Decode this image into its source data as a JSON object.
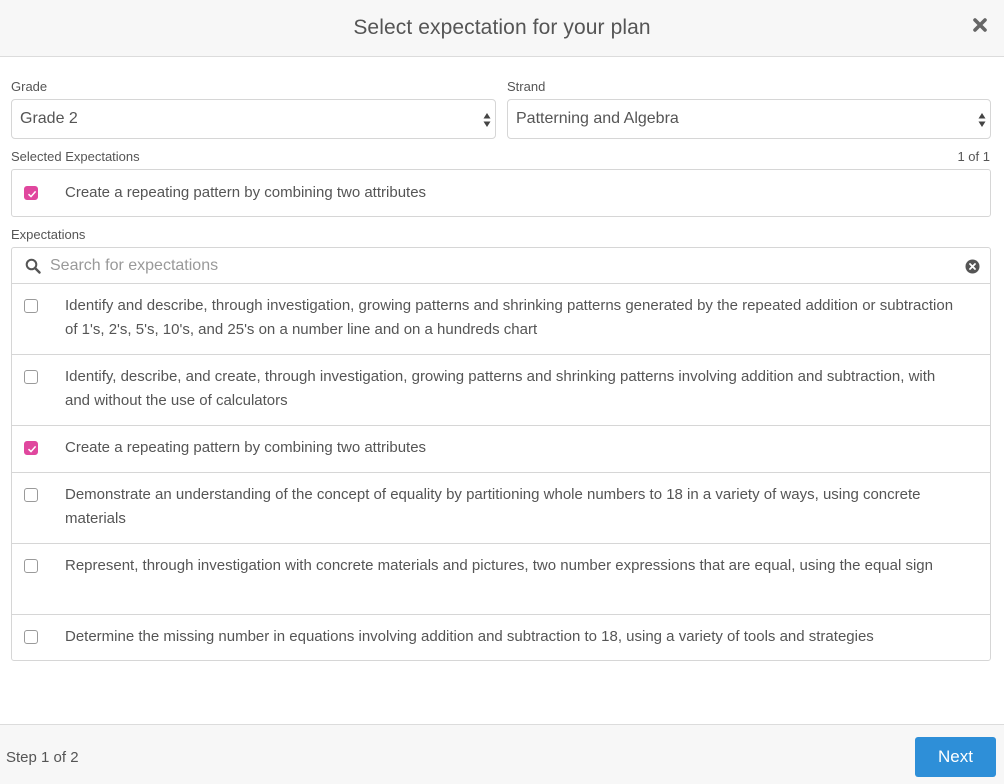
{
  "header": {
    "title": "Select expectation for your plan",
    "close_icon": "close-icon"
  },
  "grade": {
    "label": "Grade",
    "value": "Grade 2"
  },
  "strand": {
    "label": "Strand",
    "value": "Patterning and Algebra"
  },
  "selected": {
    "label": "Selected Expectations",
    "counter": "1 of 1",
    "items": [
      {
        "text": "Create a repeating pattern by combining two attributes",
        "checked": true
      }
    ]
  },
  "expectations": {
    "label": "Expectations",
    "search_placeholder": "Search for expectations",
    "search_value": "",
    "items": [
      {
        "text": "Identify and describe, through investigation, growing patterns and shrinking patterns generated by the repeated addition or subtraction of 1's, 2's, 5's, 10's, and 25's on a number line and on a hundreds chart",
        "checked": false
      },
      {
        "text": "Identify, describe, and create, through investigation, growing patterns and shrinking patterns involving addition and subtraction, with and without the use of calculators",
        "checked": false
      },
      {
        "text": "Create a repeating pattern by combining two attributes",
        "checked": true
      },
      {
        "text": "Demonstrate an understanding of the concept of equality by partitioning whole numbers to 18 in a variety of ways, using concrete materials",
        "checked": false
      },
      {
        "text": "Represent, through investigation with concrete materials and pictures, two number expressions that are equal, using the equal sign",
        "checked": false
      },
      {
        "text": "Determine the missing number in equations involving addition and subtraction to 18, using a variety of tools and strategies",
        "checked": false
      }
    ]
  },
  "footer": {
    "step": "Step 1 of 2",
    "next_label": "Next"
  },
  "colors": {
    "accent_checkbox": "#e0479e",
    "primary_button": "#2e8fd8"
  }
}
